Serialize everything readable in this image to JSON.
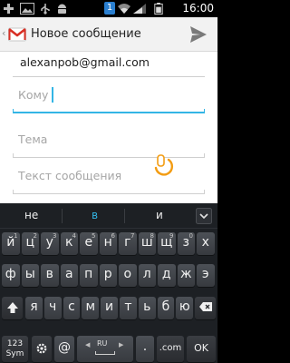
{
  "status_bar": {
    "time": "16:00",
    "notification_count": "1",
    "icons": [
      "add-icon",
      "gallery-icon",
      "usb-icon",
      "android-debug-icon",
      "notification-badge",
      "wifi-icon",
      "signal-icon",
      "battery-icon"
    ]
  },
  "action_bar": {
    "back_glyph": "‹",
    "title": "Новое сообщение",
    "icons": [
      "gmail-icon",
      "send-icon"
    ]
  },
  "compose": {
    "from_value": "alexanpob@gmail.com",
    "to_placeholder": "Кому",
    "subject_placeholder": "Тема",
    "body_placeholder": "Текст сообщения",
    "accent_color": "#33b5e5"
  },
  "keyboard": {
    "suggestions": [
      "не",
      "в",
      "и"
    ],
    "highlighted_suggestion": "в",
    "row1": [
      {
        "k": "й",
        "s": "1"
      },
      {
        "k": "ц",
        "s": "2"
      },
      {
        "k": "у",
        "s": "3"
      },
      {
        "k": "к",
        "s": "4"
      },
      {
        "k": "е",
        "s": "5"
      },
      {
        "k": "н",
        "s": "6"
      },
      {
        "k": "г",
        "s": "7"
      },
      {
        "k": "ш",
        "s": "8"
      },
      {
        "k": "щ",
        "s": "9"
      },
      {
        "k": "з",
        "s": "0"
      },
      {
        "k": "х",
        "s": ""
      }
    ],
    "row2": [
      "ф",
      "ы",
      "в",
      "а",
      "п",
      "р",
      "о",
      "л",
      "д",
      "ж",
      "э"
    ],
    "row3": [
      "я",
      "ч",
      "с",
      "м",
      "и",
      "т",
      "ь",
      "б",
      "ю"
    ],
    "sym_key": "123\nSym",
    "at_key": "@",
    "space_lang": "RU",
    "dotcom_key": ".com",
    "ok_key": "OK",
    "key_color": "#42464b",
    "background_color": "#1d2024"
  }
}
